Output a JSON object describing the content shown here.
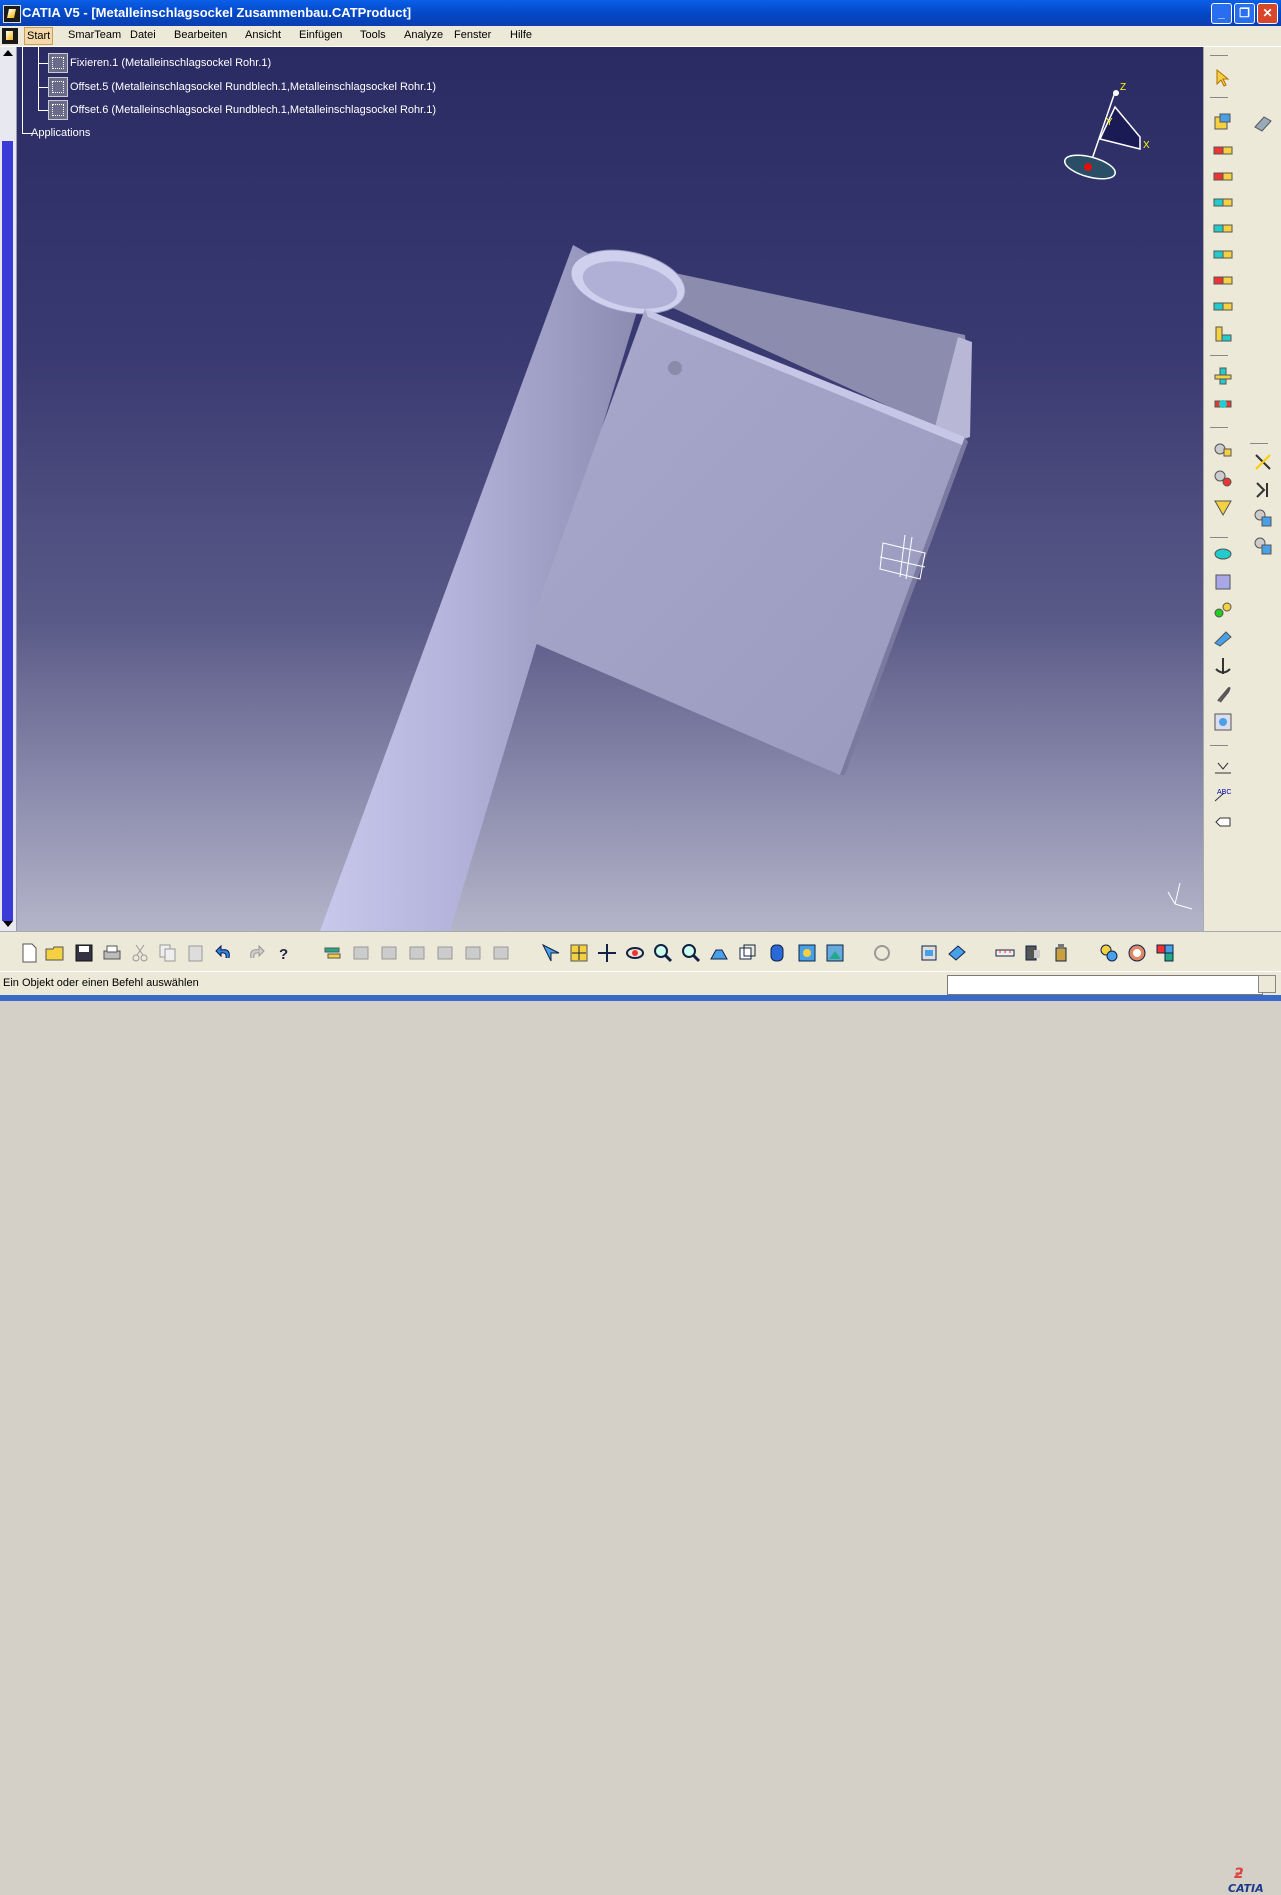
{
  "window": {
    "title": "CATIA V5 - [Metalleinschlagsockel Zusammenbau.CATProduct]",
    "minimize": "_",
    "restore": "❐",
    "close": "✕"
  },
  "menu": {
    "items": [
      "Start",
      "SmarTeam",
      "Datei",
      "Bearbeiten",
      "Ansicht",
      "Einfügen",
      "Tools",
      "Analyze",
      "Fenster",
      "Hilfe"
    ],
    "mdi_minimize": "–",
    "mdi_restore": "❐",
    "mdi_close": "✕"
  },
  "tree": {
    "nodes": [
      "Fixieren.1 (Metalleinschlagsockel Rohr.1)",
      "Offset.5 (Metalleinschlagsockel Rundblech.1,Metalleinschlagsockel Rohr.1)",
      "Offset.6 (Metalleinschlagsockel Rundblech.1,Metalleinschlagsockel Rohr.1)",
      "Applications"
    ]
  },
  "compass": {
    "x": "X",
    "y": "Y",
    "z": "Z"
  },
  "status": {
    "message": "Ein Objekt oder einen Befehl auswählen",
    "command_value": ""
  },
  "brand": {
    "logo": "CATIA"
  },
  "colors": {
    "viewport_top": "#2b2b63",
    "viewport_bottom": "#b4b4c9",
    "part_fill": "#a9a9cf",
    "titlebar": "#0a5fe8"
  },
  "icons": {
    "right_toolbar": [
      "select-arrow-icon",
      "sketch-icon",
      "constraint-icon",
      "constraint-icon",
      "constraint-icon",
      "constraint-icon",
      "constraint-icon",
      "constraint-icon",
      "constraint-icon",
      "constraint-icon",
      "manipulate-icon",
      "snap-icon",
      "existing-component-icon",
      "new-component-icon",
      "explode-icon",
      "clash-icon",
      "section-icon",
      "distance-icon",
      "sag-icon",
      "annotation-icon",
      "weld-icon",
      "catalog-icon",
      "measure-icon",
      "text-icon",
      "flag-icon"
    ],
    "bottom_toolbar": [
      "new-icon",
      "open-icon",
      "save-icon",
      "print-icon",
      "cut-icon",
      "copy-icon",
      "paste-icon",
      "undo-icon",
      "redo-icon",
      "help-icon",
      "update-icon",
      "fit-all-icon",
      "pan-icon",
      "rotate-icon",
      "zoom-in-icon",
      "zoom-out-icon",
      "normal-view-icon",
      "views-icon",
      "render-style-icon",
      "hide-show-icon",
      "swap-icon",
      "measure-icon",
      "catalog-icon",
      "material-icon"
    ]
  }
}
